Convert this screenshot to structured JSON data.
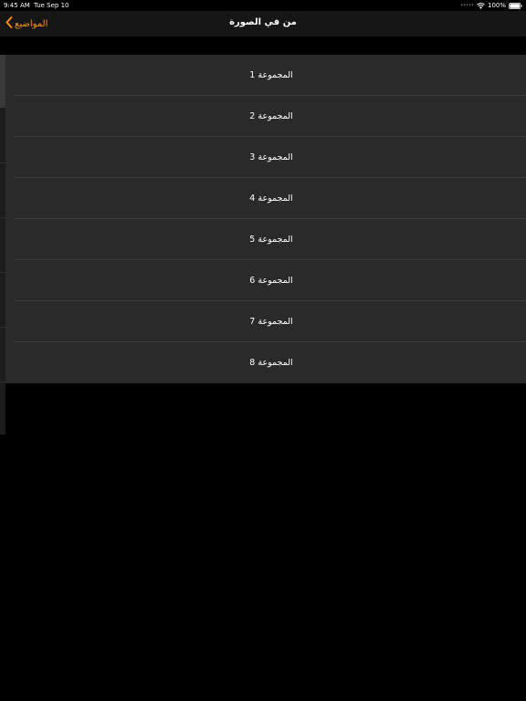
{
  "status_bar": {
    "time": "9:45 AM",
    "date": "Tue Sep 10",
    "signal": "•••••",
    "battery": "100%",
    "wifi_icon": "wifi-icon",
    "battery_icon": "battery-icon"
  },
  "nav": {
    "back_label": "المواضيع",
    "back_icon": "chevron-left-icon",
    "title": "من في الصورة",
    "accent_color": "#ff9500"
  },
  "groups": {
    "items": [
      {
        "label": "المجموعة 1"
      },
      {
        "label": "المجموعة 2"
      },
      {
        "label": "المجموعة 3"
      },
      {
        "label": "المجموعة 4"
      },
      {
        "label": "المجموعة 5"
      },
      {
        "label": "المجموعة 6"
      },
      {
        "label": "المجموعة 7"
      },
      {
        "label": "المجموعة 8"
      }
    ]
  }
}
